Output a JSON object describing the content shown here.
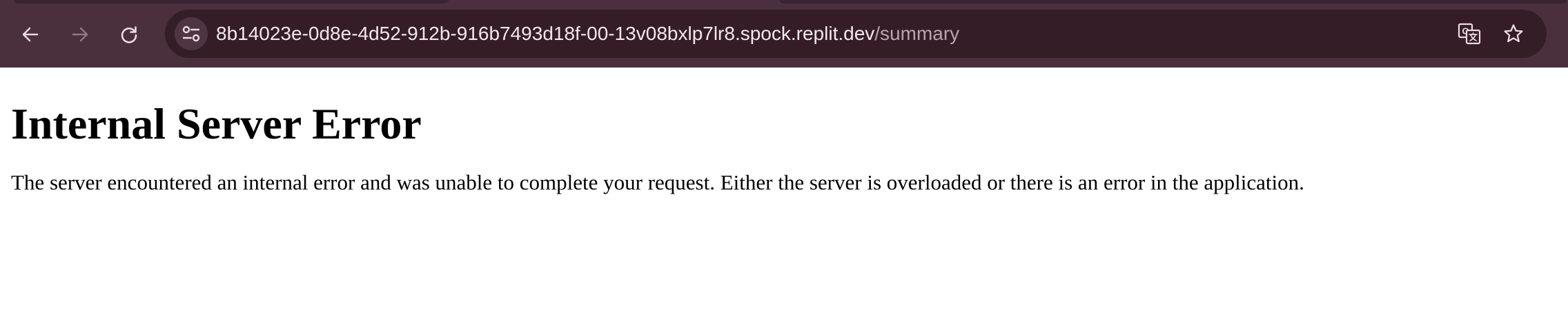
{
  "browser": {
    "url_host": "8b14023e-0d8e-4d52-912b-916b7493d18f-00-13v08bxlp7lr8.spock.replit.dev",
    "url_path": "/summary",
    "icons": {
      "back": "arrow-left-icon",
      "forward": "arrow-right-icon",
      "reload": "reload-icon",
      "site_info": "tune-icon",
      "translate": "translate-icon",
      "bookmark": "star-icon"
    },
    "colors": {
      "toolbar": "#4a2f3c",
      "omnibox": "#351d27",
      "url_text": "#f3e7ed",
      "url_path_text": "#b9a4ae"
    }
  },
  "page": {
    "heading": "Internal Server Error",
    "message": "The server encountered an internal error and was unable to complete your request. Either the server is overloaded or there is an error in the application."
  }
}
